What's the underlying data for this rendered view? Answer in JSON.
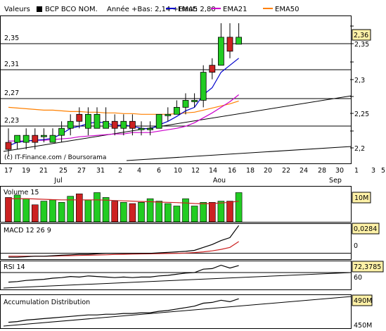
{
  "header": {
    "label": "Valeurs",
    "instrument": "BCP BCO NOM.",
    "range_text": "Année +Bas: 2,14 +Haut: 2,80",
    "legend": [
      {
        "name": "EMA5",
        "color": "#0000cc"
      },
      {
        "name": "EMA21",
        "color": "#cc00cc"
      },
      {
        "name": "EMA50",
        "color": "#ff8000"
      }
    ]
  },
  "price_panel": {
    "left_levels": [
      "2,35",
      "2,31",
      "2,27",
      "2,23"
    ],
    "right_ticks": [
      "2,35",
      "2,3",
      "2,25",
      "2,2"
    ],
    "current_value": "2,36",
    "watermark": "(c) IT-Finance.com / Boursorama"
  },
  "xaxis": {
    "day_labels": [
      "17",
      "19",
      "21",
      "25",
      "27",
      "31",
      "2",
      "4",
      "6",
      "10",
      "12",
      "14",
      "16",
      "18",
      "20",
      "22",
      "24",
      "28",
      "30",
      "1",
      "3",
      "5"
    ],
    "month_labels": [
      "Jul",
      "Aou",
      "Sep"
    ]
  },
  "volume_panel": {
    "title": "Volume 15",
    "value_badge": "10M"
  },
  "macd_panel": {
    "title": "MACD 12 26 9",
    "value_badge": "0,0284",
    "zero_label": "0"
  },
  "rsi_panel": {
    "title": "RSI 14",
    "value_badge": "72,3785",
    "level_label": "60"
  },
  "ad_panel": {
    "title": "Accumulation Distribution",
    "value_badge": "490M",
    "bottom_label": "450M"
  },
  "colors": {
    "up": "#22cc22",
    "down": "#cc2222",
    "badge": "#fff2a8",
    "ema5": "#0000cc",
    "ema21": "#cc00cc",
    "ema50": "#ff8000"
  },
  "chart_data": {
    "type": "candlestick",
    "ylim": [
      2.18,
      2.39
    ],
    "candles": [
      {
        "date": "17",
        "open": 2.21,
        "high": 2.23,
        "low": 2.19,
        "close": 2.2
      },
      {
        "date": "18",
        "open": 2.21,
        "high": 2.22,
        "low": 2.2,
        "close": 2.22
      },
      {
        "date": "19",
        "open": 2.21,
        "high": 2.23,
        "low": 2.2,
        "close": 2.22
      },
      {
        "date": "20",
        "open": 2.22,
        "high": 2.23,
        "low": 2.2,
        "close": 2.21
      },
      {
        "date": "21",
        "open": 2.22,
        "high": 2.23,
        "low": 2.21,
        "close": 2.22
      },
      {
        "date": "24",
        "open": 2.21,
        "high": 2.23,
        "low": 2.21,
        "close": 2.22
      },
      {
        "date": "25",
        "open": 2.22,
        "high": 2.24,
        "low": 2.21,
        "close": 2.23
      },
      {
        "date": "26",
        "open": 2.23,
        "high": 2.25,
        "low": 2.22,
        "close": 2.24
      },
      {
        "date": "27",
        "open": 2.25,
        "high": 2.26,
        "low": 2.23,
        "close": 2.24
      },
      {
        "date": "28",
        "open": 2.23,
        "high": 2.26,
        "low": 2.22,
        "close": 2.25
      },
      {
        "date": "31",
        "open": 2.23,
        "high": 2.26,
        "low": 2.23,
        "close": 2.25
      },
      {
        "date": "1",
        "open": 2.23,
        "high": 2.26,
        "low": 2.23,
        "close": 2.24
      },
      {
        "date": "2",
        "open": 2.24,
        "high": 2.25,
        "low": 2.22,
        "close": 2.23
      },
      {
        "date": "3",
        "open": 2.23,
        "high": 2.25,
        "low": 2.22,
        "close": 2.24
      },
      {
        "date": "4",
        "open": 2.24,
        "high": 2.25,
        "low": 2.22,
        "close": 2.23
      },
      {
        "date": "7",
        "open": 2.23,
        "high": 2.24,
        "low": 2.22,
        "close": 2.23
      },
      {
        "date": "8",
        "open": 2.23,
        "high": 2.24,
        "low": 2.22,
        "close": 2.23
      },
      {
        "date": "10",
        "open": 2.23,
        "high": 2.25,
        "low": 2.23,
        "close": 2.25
      },
      {
        "date": "11",
        "open": 2.25,
        "high": 2.26,
        "low": 2.24,
        "close": 2.25
      },
      {
        "date": "12",
        "open": 2.25,
        "high": 2.27,
        "low": 2.25,
        "close": 2.26
      },
      {
        "date": "14",
        "open": 2.26,
        "high": 2.28,
        "low": 2.25,
        "close": 2.27
      },
      {
        "date": "15",
        "open": 2.27,
        "high": 2.28,
        "low": 2.26,
        "close": 2.27
      },
      {
        "date": "16",
        "open": 2.27,
        "high": 2.32,
        "low": 2.26,
        "close": 2.31
      },
      {
        "date": "17",
        "open": 2.32,
        "high": 2.33,
        "low": 2.3,
        "close": 2.31
      },
      {
        "date": "18",
        "open": 2.32,
        "high": 2.38,
        "low": 2.32,
        "close": 2.36
      },
      {
        "date": "21",
        "open": 2.36,
        "high": 2.38,
        "low": 2.33,
        "close": 2.34
      },
      {
        "date": "22",
        "open": 2.35,
        "high": 2.38,
        "low": 2.35,
        "close": 2.36
      }
    ],
    "ema5": [
      2.205,
      2.21,
      2.212,
      2.213,
      2.214,
      2.216,
      2.222,
      2.23,
      2.233,
      2.237,
      2.239,
      2.238,
      2.234,
      2.235,
      2.233,
      2.23,
      2.229,
      2.235,
      2.24,
      2.247,
      2.255,
      2.26,
      2.278,
      2.288,
      2.31,
      2.32,
      2.33
    ],
    "ema21": [
      2.212,
      2.212,
      2.212,
      2.213,
      2.213,
      2.214,
      2.215,
      2.216,
      2.218,
      2.219,
      2.22,
      2.221,
      2.222,
      2.222,
      2.224,
      2.224,
      2.224,
      2.226,
      2.228,
      2.23,
      2.233,
      2.238,
      2.245,
      2.252,
      2.26,
      2.268,
      2.278
    ],
    "ema50": [
      2.26,
      2.259,
      2.258,
      2.257,
      2.256,
      2.256,
      2.255,
      2.254,
      2.254,
      2.253,
      2.253,
      2.252,
      2.252,
      2.251,
      2.251,
      2.25,
      2.25,
      2.25,
      2.25,
      2.251,
      2.252,
      2.253,
      2.256,
      2.259,
      2.262,
      2.265,
      2.269
    ],
    "volume": [
      2,
      2.2,
      1.9,
      1.4,
      1.7,
      1.8,
      1.6,
      2.1,
      2.3,
      1.8,
      2.4,
      2.0,
      1.7,
      1.6,
      1.5,
      1.6,
      1.9,
      1.7,
      1.5,
      1.3,
      1.9,
      1.3,
      1.6,
      1.6,
      1.7,
      1.7,
      2.4
    ],
    "volume_ma": [
      1.9,
      1.9,
      1.9,
      1.88,
      1.85,
      1.82,
      1.8,
      1.8,
      1.8,
      1.8,
      1.8,
      1.78,
      1.75,
      1.72,
      1.7,
      1.67,
      1.65,
      1.62,
      1.6,
      1.58,
      1.55,
      1.5,
      1.48,
      1.5,
      1.55,
      1.6,
      1.7
    ],
    "macd_line": [
      -0.004,
      -0.004,
      -0.0035,
      -0.003,
      -0.003,
      -0.0025,
      -0.002,
      -0.0015,
      -0.001,
      -0.001,
      -0.0005,
      0,
      0,
      0,
      0,
      0,
      0,
      0.0005,
      0.001,
      0.0015,
      0.002,
      0.003,
      0.006,
      0.009,
      0.013,
      0.016,
      0.0284
    ],
    "macd_signal": [
      -0.003,
      -0.003,
      -0.003,
      -0.003,
      -0.003,
      -0.0028,
      -0.0026,
      -0.0024,
      -0.0022,
      -0.002,
      -0.0018,
      -0.0015,
      -0.0012,
      -0.001,
      -0.0008,
      -0.0006,
      -0.0005,
      -0.0004,
      -0.0002,
      0,
      0.0003,
      0.0008,
      0.0015,
      0.0025,
      0.004,
      0.006,
      0.012
    ],
    "rsi": [
      43,
      44,
      46,
      47,
      48,
      50,
      51,
      53,
      52,
      54,
      53,
      52,
      51,
      52,
      51,
      52,
      52,
      54,
      55,
      57,
      59,
      60,
      66,
      67,
      73,
      68,
      72.3785
    ],
    "ad": [
      458,
      459,
      461,
      462,
      463,
      464,
      465,
      466,
      467,
      468,
      468,
      469,
      469,
      470,
      470,
      471,
      471,
      473,
      474,
      476,
      478,
      480,
      484,
      485,
      488,
      486,
      490
    ]
  }
}
